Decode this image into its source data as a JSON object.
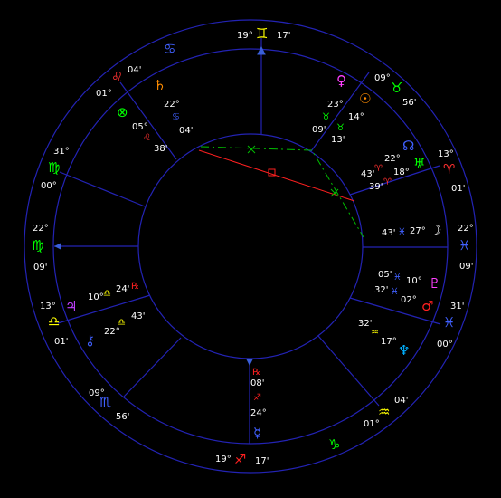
{
  "colors": {
    "background": "#000000",
    "wheel_line": "#2323b4",
    "arrow_line": "#3a5fd9",
    "opposition": "#ff2020",
    "trine": "#00c000",
    "text": "#ffffff"
  },
  "cusps": {
    "mc": {
      "deg": "19°",
      "sign": "♊",
      "min": "17'",
      "sign_color": "#ffff00"
    },
    "c11": {
      "deg": "09°",
      "sign": "♉",
      "min": "56'",
      "sign_color": "#00ff00"
    },
    "c12": {
      "deg": "13°",
      "sign": "♈",
      "min": "01'",
      "sign_color": "#ff3030"
    },
    "asc": {
      "deg": "22°",
      "sign": "♓",
      "min": "09'",
      "sign_color": "#4060ff"
    },
    "c2": {
      "deg": "31'",
      "sign": "♓",
      "min": "00°",
      "sign_color": "#4060ff"
    },
    "c3": {
      "deg": "04'",
      "sign": "♒",
      "min": "01°",
      "sign_color": "#ffff00"
    },
    "ic": {
      "deg": "19°",
      "sign": "♐",
      "min": "17'",
      "sign_color": "#ff2020"
    },
    "c5": {
      "deg": "09°",
      "sign": "♏",
      "min": "56'",
      "sign_color": "#4060ff"
    },
    "c6": {
      "deg": "13°",
      "sign": "♎",
      "min": "01'",
      "sign_color": "#ffff00"
    },
    "dsc": {
      "deg": "22°",
      "sign": "♍",
      "min": "09'",
      "sign_color": "#00ff00"
    },
    "c8": {
      "deg": "31°",
      "sign": "♍",
      "min": "00°",
      "sign_color": "#00ff00"
    },
    "c9": {
      "deg": "04'",
      "sign": "♌",
      "min": "01°",
      "sign_color": "#ff3030"
    },
    "c9b": {
      "sign": "♋",
      "sign_color": "#4060ff"
    }
  },
  "planets": {
    "venus": {
      "glyph": "♀",
      "color": "#ff40ff",
      "deg": "23°",
      "sign": "♉",
      "min": "09'"
    },
    "sun": {
      "glyph": "☉",
      "color": "#ff8c00",
      "deg": "14°",
      "sign": "♉",
      "min": "13'"
    },
    "node": {
      "glyph": "☊",
      "color": "#4060ff",
      "deg": "22°",
      "sign": "♈",
      "min": "43'"
    },
    "uranus": {
      "glyph": "♅",
      "color": "#00ff00",
      "deg": "18°",
      "sign": "♈",
      "min": "39'"
    },
    "moon": {
      "glyph": "☽",
      "color": "#ffffff",
      "deg": "27°",
      "sign": "♓",
      "min": "43'"
    },
    "pluto": {
      "glyph": "♇",
      "color": "#ff40ff",
      "deg": "10°",
      "sign": "♓",
      "min": "05'"
    },
    "mars": {
      "glyph": "♂",
      "color": "#ff2020",
      "deg": "02°",
      "sign": "♓",
      "min": "32'"
    },
    "neptune": {
      "glyph": "♆",
      "color": "#00b0ff",
      "deg": "17°",
      "sign": "♒",
      "min": "32'"
    },
    "mercury": {
      "glyph": "☿",
      "color": "#4060ff",
      "deg": "24°",
      "sign": "♐",
      "min": "08'",
      "retro": "℞"
    },
    "jupiter": {
      "glyph": "♃",
      "color": "#c040ff",
      "deg": "10°",
      "sign": "♎",
      "min": "24'",
      "retro": "℞"
    },
    "chiron": {
      "glyph": "⚷",
      "color": "#4060ff",
      "deg": "22°",
      "sign": "♎",
      "min": "43'"
    },
    "saturn": {
      "glyph": "♄",
      "color": "#ff8c00",
      "deg": "22°",
      "sign": "♋",
      "min": "04'"
    },
    "fortune": {
      "glyph": "⊗",
      "color": "#00ff00",
      "deg": "05°",
      "sign": "♌",
      "min": "38'"
    }
  }
}
